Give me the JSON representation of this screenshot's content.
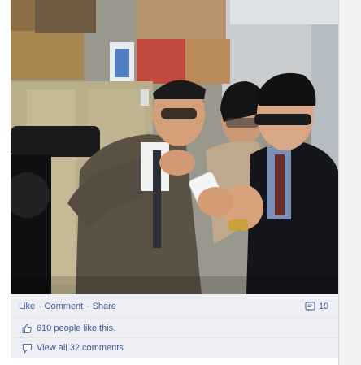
{
  "post": {
    "actions": {
      "like_label": "Like",
      "comment_label": "Comment",
      "share_label": "Share",
      "comment_count": "19"
    },
    "likes": {
      "count_text": "610",
      "suffix_text": "people like this."
    },
    "comments": {
      "view_all_label": "View all 32 comments"
    }
  },
  "icons": [
    "comment-bubble-icon",
    "thumbs-up-icon",
    "speech-bubble-icon"
  ],
  "colors": {
    "link": "#3b5998",
    "bar_background": "#edeff4"
  }
}
